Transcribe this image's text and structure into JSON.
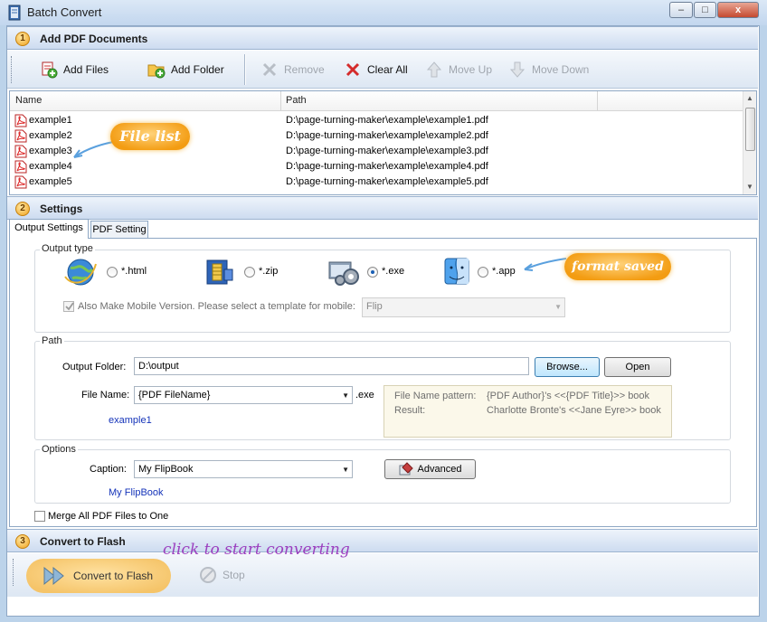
{
  "window": {
    "title": "Batch Convert",
    "min": "–",
    "max": "□",
    "close": "x"
  },
  "sections": [
    {
      "num": "1",
      "title": "Add PDF Documents"
    },
    {
      "num": "2",
      "title": "Settings"
    },
    {
      "num": "3",
      "title": "Convert to Flash"
    }
  ],
  "toolbar": {
    "add_files": "Add Files",
    "add_folder": "Add Folder",
    "remove": "Remove",
    "clear_all": "Clear All",
    "move_up": "Move Up",
    "move_down": "Move Down"
  },
  "filelist": {
    "col_name": "Name",
    "col_path": "Path",
    "rows": [
      {
        "name": "example1",
        "path": "D:\\page-turning-maker\\example\\example1.pdf"
      },
      {
        "name": "example2",
        "path": "D:\\page-turning-maker\\example\\example2.pdf"
      },
      {
        "name": "example3",
        "path": "D:\\page-turning-maker\\example\\example3.pdf"
      },
      {
        "name": "example4",
        "path": "D:\\page-turning-maker\\example\\example4.pdf"
      },
      {
        "name": "example5",
        "path": "D:\\page-turning-maker\\example\\example5.pdf"
      }
    ]
  },
  "callouts": {
    "file_list": "File list",
    "format": "format saved as",
    "convert": "click to start converting"
  },
  "tabs": {
    "output": "Output Settings",
    "pdf": "PDF Setting"
  },
  "output_type": {
    "label": "Output type",
    "html": "*.html",
    "zip": "*.zip",
    "exe": "*.exe",
    "app": "*.app",
    "selected": "exe",
    "mobile_label": "Also Make Mobile Version. Please select a template for mobile:",
    "mobile_checked": true,
    "mobile_template": "Flip"
  },
  "path": {
    "label": "Path",
    "output_folder_label": "Output Folder:",
    "output_folder": "D:\\output",
    "browse": "Browse...",
    "open": "Open",
    "file_name_label": "File Name:",
    "file_name": "{PDF FileName}",
    "ext": ".exe",
    "preview": "example1",
    "pattern_label": "File Name pattern:",
    "pattern_value": "{PDF Author}'s <<{PDF Title}>> book",
    "result_label": "Result:",
    "result_value": "Charlotte Bronte's <<Jane Eyre>> book"
  },
  "options": {
    "label": "Options",
    "caption_label": "Caption:",
    "caption": "My FlipBook",
    "caption_preview": "My FlipBook",
    "advanced": "Advanced"
  },
  "merge_label": "Merge All PDF Files to One",
  "convert": {
    "convert_button": "Convert to Flash",
    "stop": "Stop"
  }
}
